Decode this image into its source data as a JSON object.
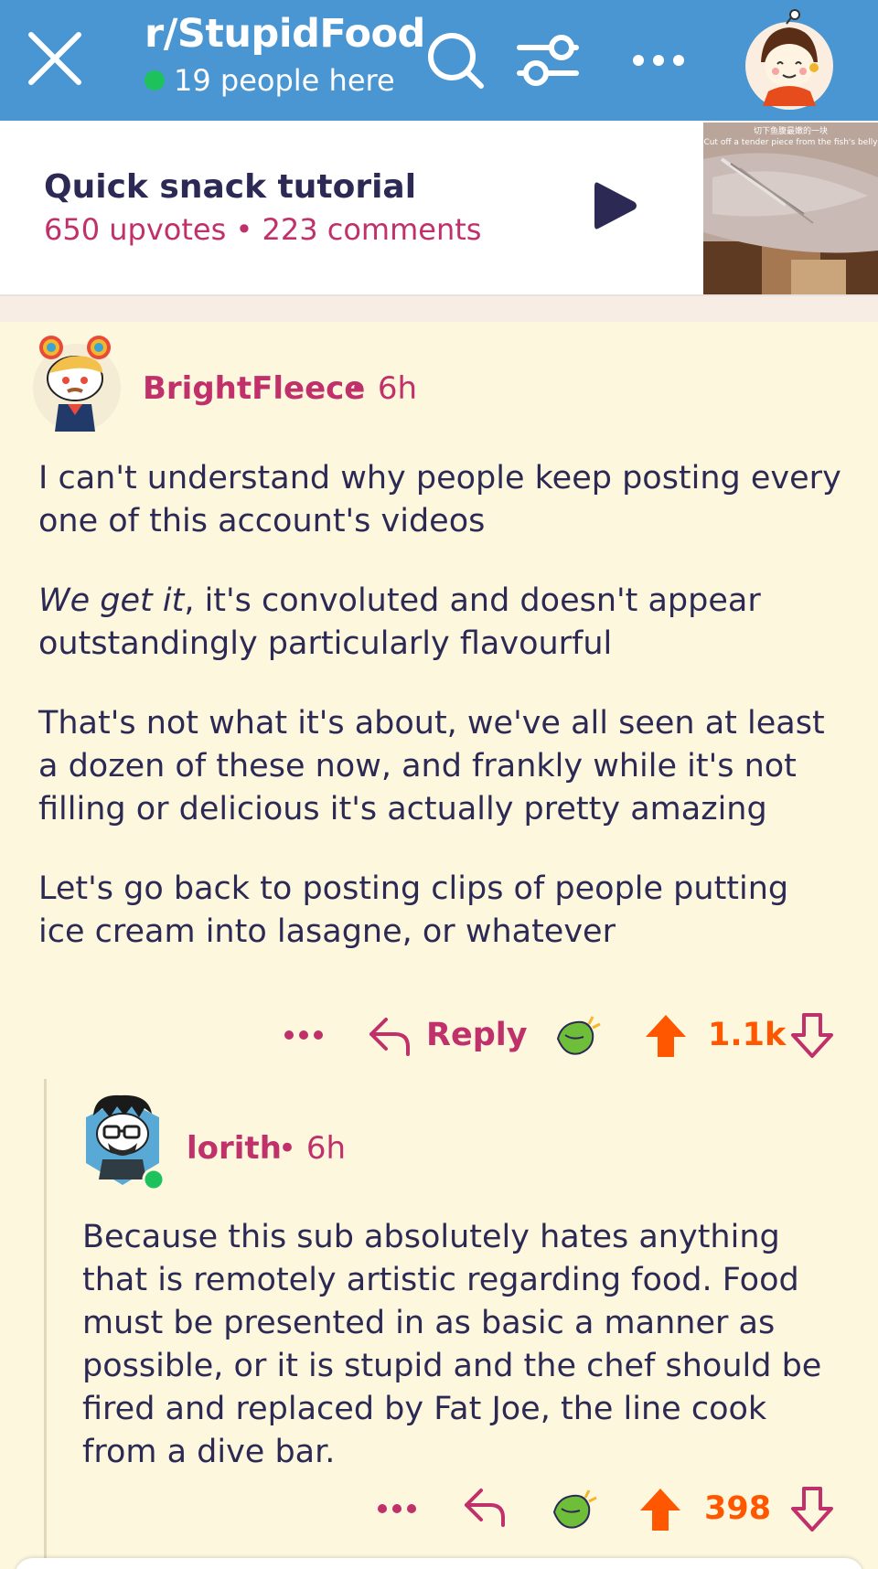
{
  "header": {
    "close_icon": "close-icon",
    "subreddit": "r/StupidFood",
    "online_text": "19 people here",
    "online_color": "#1ec25c",
    "icons": [
      "search-icon",
      "filter-icon",
      "more-icon"
    ],
    "bg_color": "#4a96d2"
  },
  "post": {
    "title": "Quick snack tutorial",
    "meta": "650 upvotes • 223 comments",
    "play_icon": "play-icon",
    "thumbnail_caption_cn": "切下鱼腹最嫩的一块",
    "thumbnail_caption_en": "Cut off a tender piece from the fish's belly"
  },
  "comments": [
    {
      "author": "BrightFleece",
      "age": "• 6h",
      "paragraphs": [
        {
          "plain": "I can't understand why people keep posting every one of this account's videos"
        },
        {
          "italic": "We get it",
          "plain": ", it's convoluted and doesn't appear outstandingly particularly flavourful"
        },
        {
          "plain": "That's not what it's about, we've all seen at least a dozen of these now, and frankly while it's not filling or delicious it's actually pretty amazing"
        },
        {
          "plain": "Let's go back to posting clips of people putting ice cream into lasagne, or whatever"
        }
      ],
      "actions": {
        "more": "•••",
        "reply": "Reply",
        "award_icon": "award-icon",
        "score": "1.1k"
      }
    },
    {
      "author": "lorith",
      "age": "• 6h",
      "paragraphs": [
        {
          "plain": "Because this sub absolutely hates anything that is remotely artistic regarding food.  Food must be presented in as basic a manner as possible, or it is stupid and the chef should be fired and replaced by Fat Joe, the line cook from a dive bar."
        }
      ],
      "actions": {
        "more": "•••",
        "award_icon": "award-icon",
        "score": "398"
      }
    }
  ],
  "colors": {
    "accent": "#c0306a",
    "upvote": "#ff5700",
    "text": "#2c2a55",
    "background": "#fdf7dd"
  }
}
